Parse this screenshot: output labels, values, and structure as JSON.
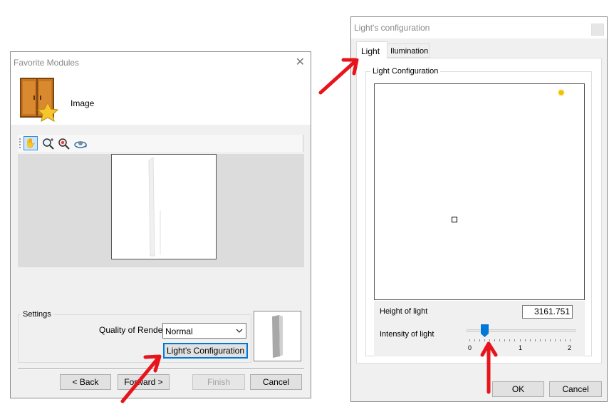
{
  "left_dialog": {
    "title": "Favorite Modules",
    "header_label": "Image",
    "toolbar_icons": [
      "hand-pan-icon",
      "zoom-in-icon",
      "zoom-icon",
      "rotate-icon"
    ],
    "settings": {
      "group_label": "Settings",
      "quality_label": "Quality of Render",
      "quality_value": "Normal",
      "light_config_button": "Light's Configuration"
    },
    "buttons": {
      "back": "< Back",
      "forward": "Forward >",
      "finish": "Finish",
      "cancel": "Cancel"
    }
  },
  "right_dialog": {
    "title": "Light's configuration",
    "tabs": [
      "Light",
      "Ilumination"
    ],
    "active_tab": "Light",
    "group_label": "Light Configuration",
    "height_label": "Height of light",
    "height_value": "3161.751",
    "intensity_label": "Intensity of light",
    "slider": {
      "min": 0,
      "max": 2,
      "value": 0.3,
      "tick_labels": [
        "0",
        "1",
        "2"
      ]
    },
    "buttons": {
      "ok": "OK",
      "cancel": "Cancel"
    }
  },
  "colors": {
    "annotation_arrow": "#e8141b",
    "focus_accent": "#0078d7",
    "sun_icon": "#f2c200"
  }
}
